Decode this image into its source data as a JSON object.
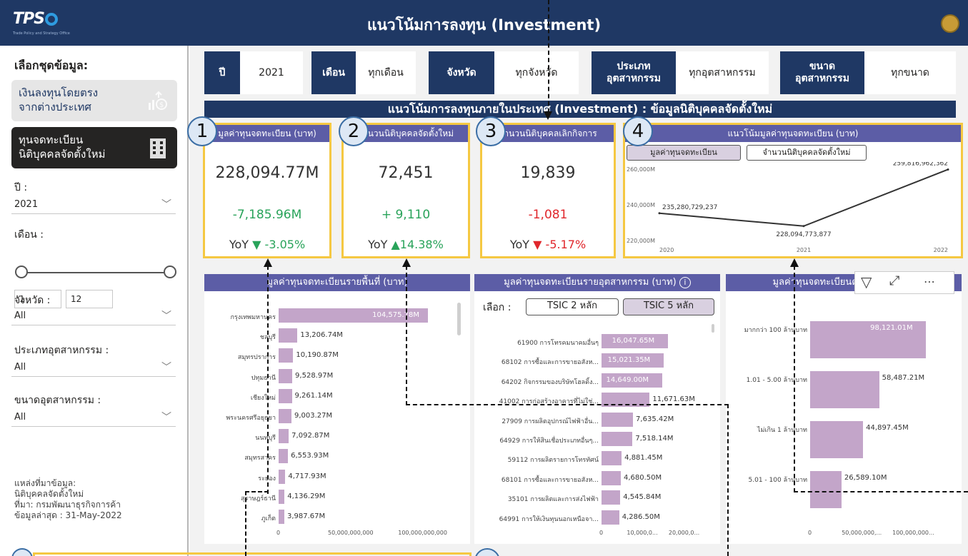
{
  "header": {
    "logo_text": "TPS",
    "logo_subtext": "Trade Policy and Strategy Office",
    "title": "แนวโน้มการลงทุน (Investment)"
  },
  "sidebar": {
    "heading": "เลือกชุดข้อมูล:",
    "datasets": [
      {
        "label_line1": "เงินลงทุนโดยตรง",
        "label_line2": "จากต่างประเทศ",
        "icon": "money-growth-icon"
      },
      {
        "label_line1": "ทุนจดทะเบียน",
        "label_line2": "นิติบุคคลจัดตั้งใหม่",
        "icon": "building-icon"
      }
    ],
    "year_label": "ปี :",
    "year_value": "2021",
    "month_label": "เดือน :",
    "month_from": "1",
    "month_to": "12",
    "province_label": "จังหวัด :",
    "province_value": "All",
    "industry_type_label": "ประเภทอุตสาหกรรม :",
    "industry_type_value": "All",
    "industry_size_label": "ขนาดอุตสาหกรรม :",
    "industry_size_value": "All",
    "source_lines": [
      "แหล่งที่มาข้อมูล:",
      "นิติบุคคลจัดตั้งใหม่",
      "ที่มา: กรมพัฒนาธุรกิจการค้า",
      "ข้อมูลล่าสุด : 31-May-2022"
    ]
  },
  "filters": [
    {
      "key": "ปี",
      "value": "2021"
    },
    {
      "key": "เดือน",
      "value": "ทุกเดือน"
    },
    {
      "key": "จังหวัด",
      "value": "ทุกจังหวัด"
    },
    {
      "key_line1": "ประเภท",
      "key_line2": "อุตสาหกรรม",
      "value": "ทุกอุตสาหกรรม"
    },
    {
      "key_line1": "ขนาด",
      "key_line2": "อุตสาหกรรม",
      "value": "ทุกขนาด"
    }
  ],
  "banner": "แนวโน้มการลงทุนภายในประเทศ (Investment) : ข้อมูลนิติบุคคลจัดตั้งใหม่",
  "kpis": [
    {
      "badge": "1",
      "title": "มูลค่าทุนจดทะเบียน (บาท)",
      "value": "228,094.77M",
      "delta": "-7,185.96M",
      "delta_color": "#29a35a",
      "yoy_label": "YoY",
      "yoy_arrow": "▼",
      "yoy_value": "-3.05%",
      "yoy_color": "#29a35a"
    },
    {
      "badge": "2",
      "title": "จำนวนนิติบุคคลจัดตั้งใหม่",
      "value": "72,451",
      "delta": "+ 9,110",
      "delta_color": "#29a35a",
      "yoy_label": "YoY",
      "yoy_arrow": "▲",
      "yoy_value": "14.38%",
      "yoy_color": "#29a35a"
    },
    {
      "badge": "3",
      "title": "จำนวนนิติบุคคลเลิกกิจการ",
      "value": "19,839",
      "delta": "-1,081",
      "delta_color": "#e0272c",
      "yoy_label": "YoY",
      "yoy_arrow": "▼",
      "yoy_value": "-5.17%",
      "yoy_color": "#e0272c"
    }
  ],
  "trend": {
    "badge": "4",
    "title": "แนวโน้มมูลค่าทุนจดทะเบียน (บาท)",
    "toggles": [
      "มูลค่าทุนจดทะเบียน",
      "จำนวนนิติบุคคลจัดตั้งใหม่"
    ],
    "selected_toggle": 0
  },
  "area_panel": {
    "title": "มูลค่าทุนจดทะเบียนรายพื้นที่ (บาท)"
  },
  "industry_panel": {
    "title": "มูลค่าทุนจดทะเบียนรายอุตสาหกรรม (บาท)",
    "select_label": "เลือก :",
    "options": [
      "TSIC 2 หลัก",
      "TSIC 5 หลัก"
    ],
    "selected_option": 1
  },
  "size_panel": {
    "title": "มูลค่าทุนจดทะเบียนตามขนาดธุรกิจ"
  },
  "chart_data": [
    {
      "type": "line",
      "title": "แนวโน้มมูลค่าทุนจดทะเบียน (บาท)",
      "x": [
        "2020",
        "2021",
        "2022"
      ],
      "series": [
        {
          "values": [
            235280729237,
            228094773877,
            259816962362
          ],
          "labels": [
            "235,280,729,237",
            "228,094,773,877",
            "259,816,962,362"
          ]
        }
      ],
      "yticks": [
        "260,000M",
        "240,000M",
        "220,000M"
      ],
      "ylim": [
        220000000000,
        260000000000
      ],
      "color": "#333333"
    },
    {
      "type": "bar",
      "orientation": "horizontal",
      "title": "มูลค่าทุนจดทะเบียนรายพื้นที่ (บาท)",
      "categories": [
        "กรุงเทพมหานคร",
        "ชลบุรี",
        "สมุทรปราการ",
        "ปทุมธานี",
        "เชียงใหม่",
        "พระนครศรีอยุธยา",
        "นนทบุรี",
        "สมุทรสาคร",
        "ระยอง",
        "สุราษฎร์ธานี",
        "ภูเก็ต"
      ],
      "values": [
        104575.78,
        13206.74,
        10190.87,
        9528.97,
        9261.14,
        9003.27,
        7092.87,
        6553.93,
        4717.93,
        4136.29,
        3987.67
      ],
      "value_labels": [
        "104,575.78M",
        "13,206.74M",
        "10,190.87M",
        "9,528.97M",
        "9,261.14M",
        "9,003.27M",
        "7,092.87M",
        "6,553.93M",
        "4,717.93M",
        "4,136.29M",
        "3,987.67M"
      ],
      "xticks": [
        "0",
        "50,000,000,000",
        "100,000,000,000"
      ],
      "xmax": 120000,
      "color": "#c3a5c9"
    },
    {
      "type": "bar",
      "orientation": "horizontal",
      "title": "มูลค่าทุนจดทะเบียนรายอุตสาหกรรม (บาท)",
      "categories": [
        "61900 การโทรคมนาคมอื่นๆ",
        "68102 การซื้อและการขายอสังห...",
        "64202 กิจกรรมของบริษัทโฮลดิ้ง...",
        "41002 การก่อสร้างอาคารที่ไม่ใช่...",
        "27909 การผลิตอุปกรณ์ไฟฟ้าอื่น...",
        "64929 การให้สินเชื่อประเภทอื่นๆ...",
        "59112 การผลิตรายการโทรทัศน์",
        "68101 การซื้อและการขายอสังห...",
        "35101 การผลิตและการส่งไฟฟ้า",
        "64991 การให้เงินทุนนอกเหนือจา..."
      ],
      "values": [
        16047.65,
        15021.35,
        14649.0,
        11671.63,
        7635.42,
        7518.14,
        4881.45,
        4680.5,
        4545.84,
        4286.5
      ],
      "value_labels": [
        "16,047.65M",
        "15,021.35M",
        "14,649.00M",
        "11,671.63M",
        "7,635.42M",
        "7,518.14M",
        "4,881.45M",
        "4,680.50M",
        "4,545.84M",
        "4,286.50M"
      ],
      "xticks": [
        "0",
        "10,000,0...",
        "20,000,0..."
      ],
      "xmax": 26000,
      "color": "#c3a5c9"
    },
    {
      "type": "bar",
      "orientation": "horizontal",
      "title": "มูลค่าทุนจดทะเบียนตามขนาดธุรกิจ",
      "categories": [
        "มากกว่า 100 ล้านบาท",
        "1.01 - 5.00 ล้านบาท",
        "ไม่เกิน 1 ล้านบาท",
        "5.01 - 100 ล้านบาท"
      ],
      "values": [
        98121.01,
        58487.21,
        44897.45,
        26589.1
      ],
      "value_labels": [
        "98,121.01M",
        "58,487.21M",
        "44,897.45M",
        "26,589.10M"
      ],
      "xticks": [
        "0",
        "50,000,000,...",
        "100,000,000..."
      ],
      "xmax": 115000,
      "color": "#c3a5c9"
    }
  ]
}
